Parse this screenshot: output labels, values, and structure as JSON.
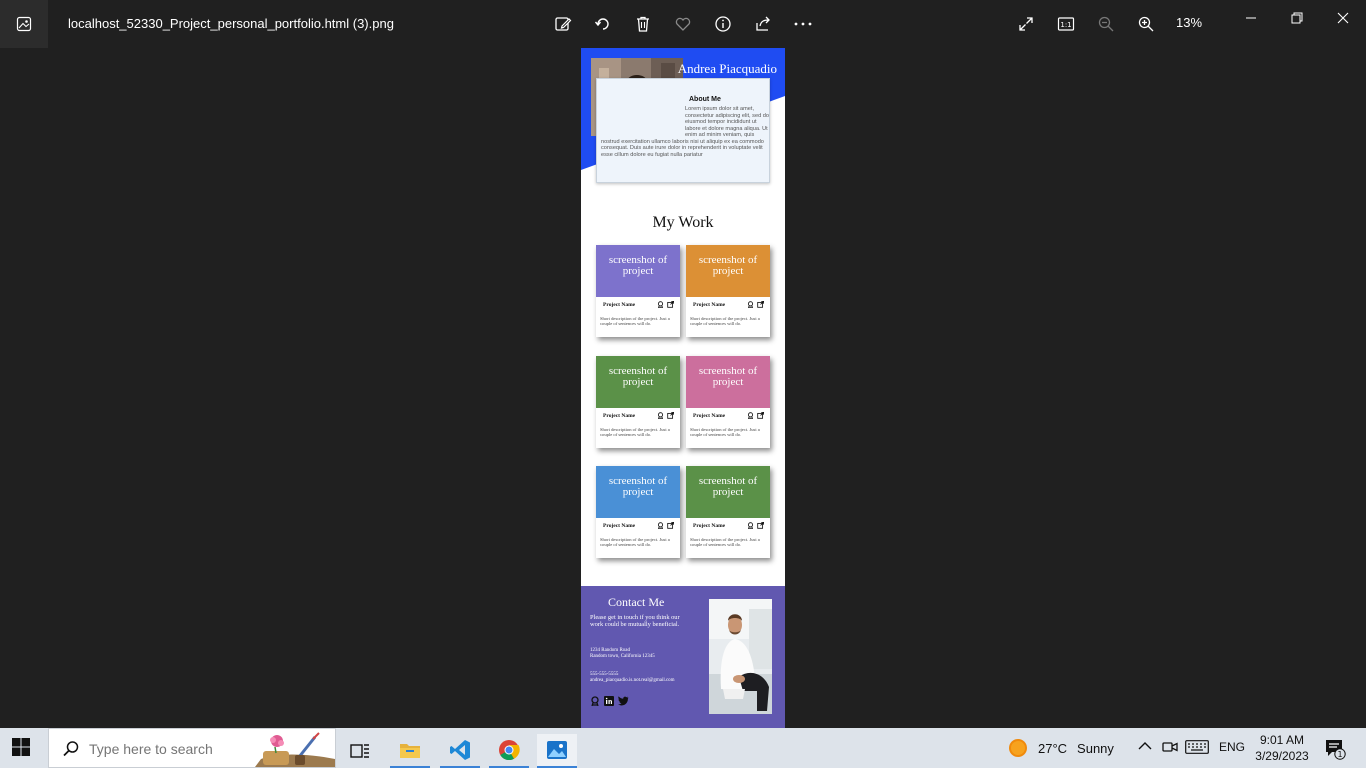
{
  "titlebar": {
    "file_name": "localhost_52330_Project_personal_portfolio.html (3).png",
    "zoom": "13%"
  },
  "portfolio": {
    "name": "Andrea Piacquadio",
    "about_title": "About Me",
    "about_text": "Lorem ipsum dolor sit amet, consectetur adipiscing elit, sed do eiusmod tempor incididunt ut labore et dolore magna aliqua. Ut enim ad minim veniam, quis nostrud exercitation ullamco laboris nisi ut aliquip ex ea commodo consequat. Duis aute irure dolor in reprehenderit in voluptate velit esse cillum dolore eu fugiat nulla pariatur",
    "work_title": "My Work",
    "projects": [
      {
        "shot": "screenshot of project",
        "name": "Project Name",
        "desc": "Short description of the project. Just a couple of sentences will do.",
        "color": "#7d72cc"
      },
      {
        "shot": "screenshot of project",
        "name": "Project Name",
        "desc": "Short description of the project. Just a couple of sentences will do.",
        "color": "#dc9035"
      },
      {
        "shot": "screenshot of project",
        "name": "Project Name",
        "desc": "Short description of the project. Just a couple of sentences will do.",
        "color": "#5b9148"
      },
      {
        "shot": "screenshot of project",
        "name": "Project Name",
        "desc": "Short description of the project. Just a couple of sentences will do.",
        "color": "#cc6f9d"
      },
      {
        "shot": "screenshot of project",
        "name": "Project Name",
        "desc": "Short description of the project. Just a couple of sentences will do.",
        "color": "#4a90d6"
      },
      {
        "shot": "screenshot of project",
        "name": "Project Name",
        "desc": "Short description of the project. Just a couple of sentences will do.",
        "color": "#5b9148"
      }
    ],
    "contact": {
      "title": "Contact Me",
      "desc": "Please get in touch if you think our work could be mutually beneficial.",
      "address1": "1234 Random Road",
      "address2": "Random town, California 12345",
      "phone": "555-555-5555",
      "email": "andrea_piacquadio.is.not.real@gmail.com"
    },
    "colors": {
      "hero_blue": "#1f4cf2",
      "contact_purple": "#6158b0"
    }
  },
  "taskbar": {
    "search_placeholder": "Type here to search",
    "weather_temp": "27°C",
    "weather_desc": "Sunny",
    "language": "ENG",
    "time": "9:01 AM",
    "date": "3/29/2023",
    "notification_count": "1"
  }
}
